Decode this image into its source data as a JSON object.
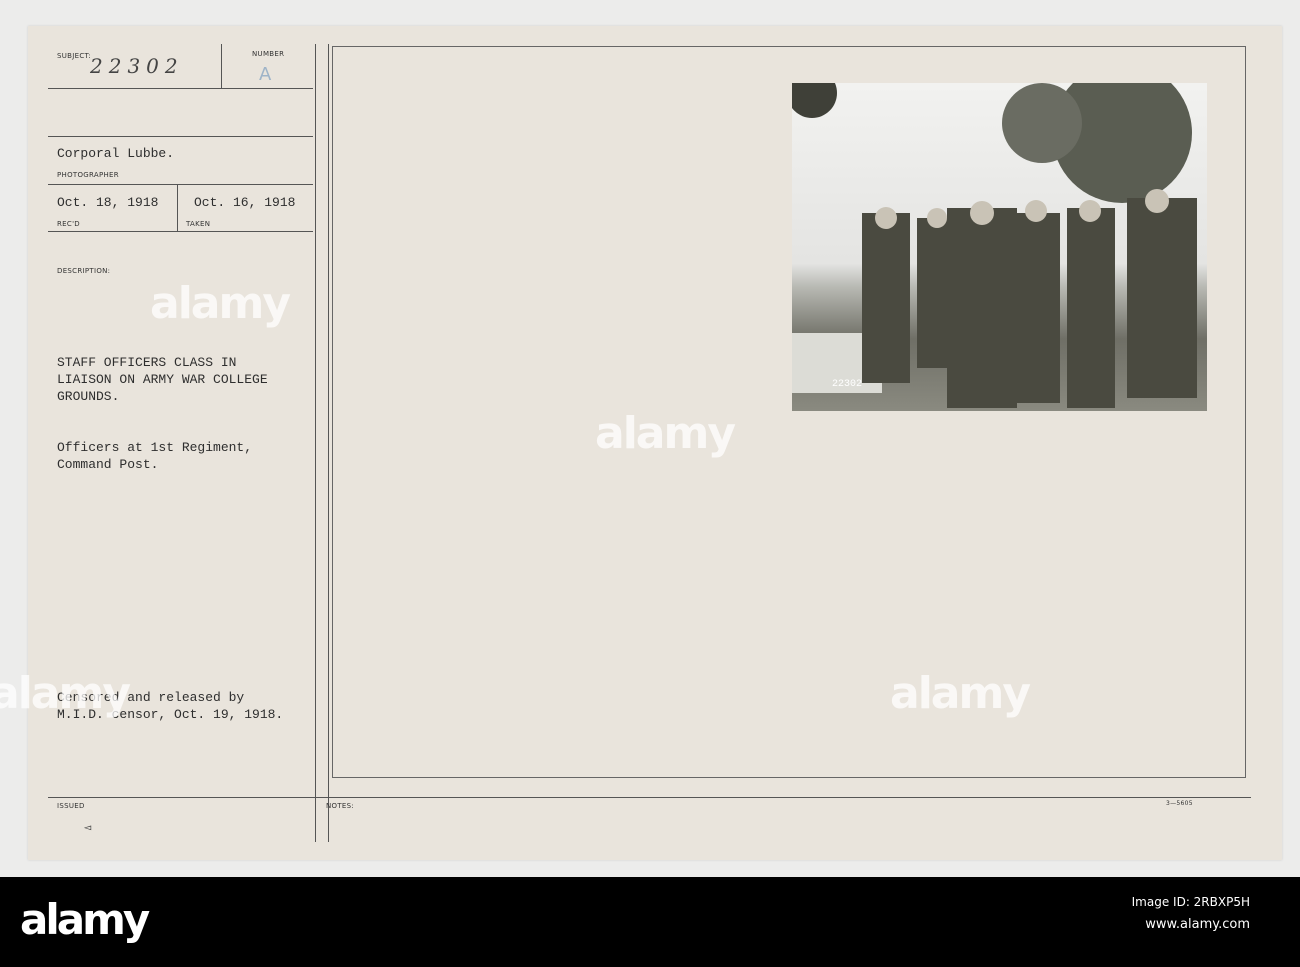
{
  "card": {
    "subject_label": "SUBJECT:",
    "subject_value": "22302",
    "number_label": "NUMBER",
    "number_value": "A",
    "photographer": "Corporal Lubbe.",
    "photographer_label": "PHOTOGRAPHER",
    "received": "Oct. 18, 1918",
    "received_label": "REC'D",
    "taken": "Oct. 16, 1918",
    "taken_label": "TAKEN",
    "description_label": "DESCRIPTION:",
    "description": "STAFF OFFICERS CLASS IN\nLIAISON ON ARMY WAR COLLEGE\nGROUNDS.",
    "note": "Officers at 1st Regiment,\nCommand Post.",
    "censor": "Censored and released by\nM.I.D. censor, Oct. 19, 1918.",
    "issued_label": "ISSUED",
    "issued_mark": "◅",
    "notes_label": "NOTES:",
    "form_number": "3—5605",
    "photo_number": "22302"
  },
  "watermark": "alamy",
  "footer": {
    "logo": "alamy",
    "image_id": "Image ID: 2RBXP5H",
    "url": "www.alamy.com"
  }
}
